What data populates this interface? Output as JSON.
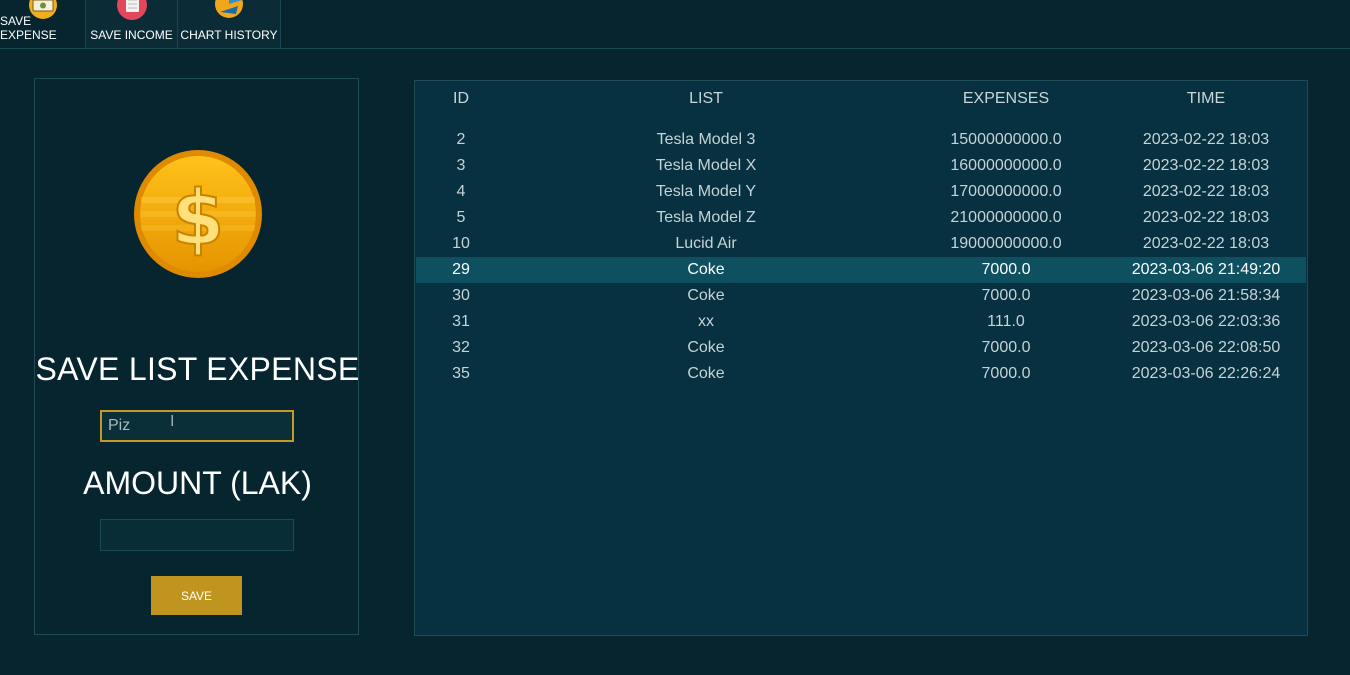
{
  "toolbar": {
    "items": [
      {
        "label": "SAVE EXPENSE",
        "icon": "money-bill-icon"
      },
      {
        "label": "SAVE INCOME",
        "icon": "notebook-icon"
      },
      {
        "label": "CHART HISTORY",
        "icon": "pie-chart-icon"
      }
    ]
  },
  "form": {
    "title": "SAVE LIST EXPENSE",
    "list_value": "Piz",
    "amount_label": "AMOUNT (LAK)",
    "amount_value": "",
    "save_label": "SAVE"
  },
  "table": {
    "columns": [
      "ID",
      "LIST",
      "EXPENSES",
      "TIME"
    ],
    "rows": [
      {
        "id": "2",
        "list": "Tesla Model 3",
        "expenses": "15000000000.0",
        "time": "2023-02-22 18:03",
        "selected": false
      },
      {
        "id": "3",
        "list": "Tesla Model X",
        "expenses": "16000000000.0",
        "time": "2023-02-22 18:03",
        "selected": false
      },
      {
        "id": "4",
        "list": "Tesla Model Y",
        "expenses": "17000000000.0",
        "time": "2023-02-22 18:03",
        "selected": false
      },
      {
        "id": "5",
        "list": "Tesla Model Z",
        "expenses": "21000000000.0",
        "time": "2023-02-22 18:03",
        "selected": false
      },
      {
        "id": "10",
        "list": "Lucid Air",
        "expenses": "19000000000.0",
        "time": "2023-02-22 18:03",
        "selected": false
      },
      {
        "id": "29",
        "list": "Coke",
        "expenses": "7000.0",
        "time": "2023-03-06 21:49:20",
        "selected": true
      },
      {
        "id": "30",
        "list": "Coke",
        "expenses": "7000.0",
        "time": "2023-03-06 21:58:34",
        "selected": false
      },
      {
        "id": "31",
        "list": "xx",
        "expenses": "111.0",
        "time": "2023-03-06 22:03:36",
        "selected": false
      },
      {
        "id": "32",
        "list": "Coke",
        "expenses": "7000.0",
        "time": "2023-03-06 22:08:50",
        "selected": false
      },
      {
        "id": "35",
        "list": "Coke",
        "expenses": "7000.0",
        "time": "2023-03-06 22:26:24",
        "selected": false
      }
    ]
  },
  "colors": {
    "background": "#06252e",
    "panel": "#073140",
    "accent": "#c0951f",
    "selected_row": "#0e5060"
  }
}
